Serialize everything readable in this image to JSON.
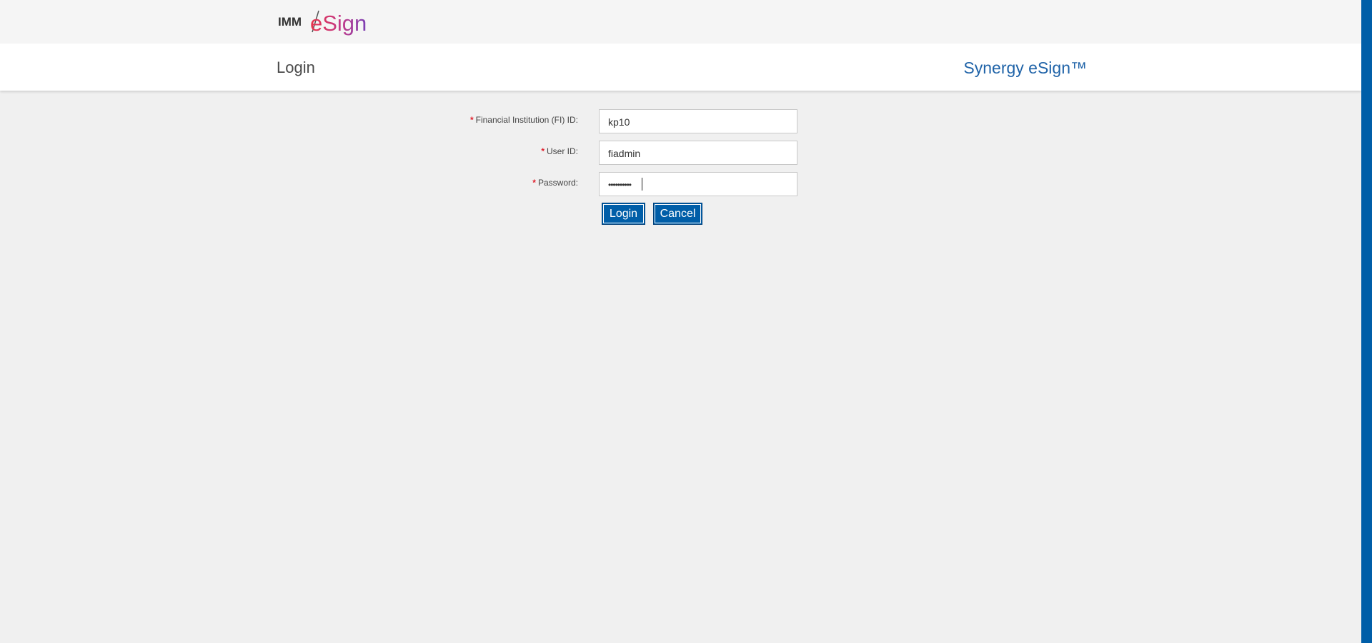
{
  "brand": {
    "logo_prefix": "IMM",
    "logo_main": "eSign"
  },
  "header": {
    "page_title": "Login",
    "product_name": "Synergy eSign™"
  },
  "form": {
    "required_marker": "*",
    "fi_id": {
      "label": "Financial Institution (FI) ID:",
      "value": "kp10"
    },
    "user_id": {
      "label": "User ID:",
      "value": "fiadmin"
    },
    "password": {
      "label": "Password:",
      "masked_value": "••••••••••"
    }
  },
  "buttons": {
    "login": "Login",
    "cancel": "Cancel"
  },
  "colors": {
    "accent": "#005ea8",
    "product_text": "#1f63a8",
    "required": "#e0202d",
    "background": "#f0f0f0"
  }
}
